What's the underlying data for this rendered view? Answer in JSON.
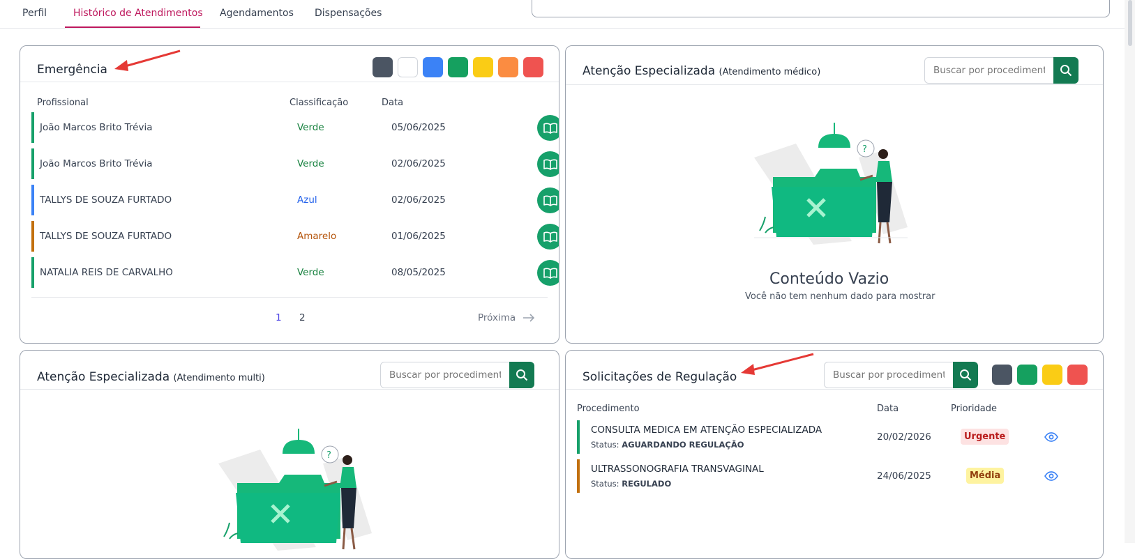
{
  "tabs": [
    {
      "label": "Perfil",
      "active": false
    },
    {
      "label": "Histórico de Atendimentos",
      "active": true
    },
    {
      "label": "Agendamentos",
      "active": false
    },
    {
      "label": "Dispensações",
      "active": false
    }
  ],
  "colors": {
    "accent": "#be185d",
    "primary_green": "#16a06a",
    "dark_green": "#137a52",
    "annotation_arrow": "#e53935"
  },
  "emergencia": {
    "title": "Emergência",
    "swatches": [
      "#4b5563",
      "#ffffff",
      "#3b82f6",
      "#15a05f",
      "#facc15",
      "#fb8c41",
      "#ef5350"
    ],
    "columns": {
      "profissional": "Profissional",
      "classificacao": "Classificação",
      "data": "Data"
    },
    "rows": [
      {
        "name": "João Marcos Brito Trévia",
        "class": "Verde",
        "date": "05/06/2025",
        "color": "#15803d",
        "bar": "#16a06a",
        "icon": "book-icon"
      },
      {
        "name": "João Marcos Brito Trévia",
        "class": "Verde",
        "date": "02/06/2025",
        "color": "#15803d",
        "bar": "#16a06a",
        "icon": "book-icon"
      },
      {
        "name": "TALLYS DE SOUZA FURTADO",
        "class": "Azul",
        "date": "02/06/2025",
        "color": "#2563eb",
        "bar": "#3b82f6",
        "icon": "book-icon"
      },
      {
        "name": "TALLYS DE SOUZA FURTADO",
        "class": "Amarelo",
        "date": "01/06/2025",
        "color": "#b45309",
        "bar": "#c2700d",
        "icon": "book-icon"
      },
      {
        "name": "NATALIA REIS DE CARVALHO",
        "class": "Verde",
        "date": "08/05/2025",
        "color": "#15803d",
        "bar": "#16a06a",
        "icon": "book-icon"
      }
    ],
    "pagination": {
      "pages": [
        "1",
        "2"
      ],
      "current": "1",
      "next_label": "Próxima",
      "next_icon": "arrow-right-icon"
    }
  },
  "atencao_medico": {
    "title": "Atenção Especializada",
    "subtitle": "(Atendimento médico)",
    "search_placeholder": "Buscar por procedimento...",
    "search_icon": "search-icon",
    "empty_title": "Conteúdo Vazio",
    "empty_subtitle": "Você não tem nenhum dado para mostrar"
  },
  "atencao_multi": {
    "title": "Atenção Especializada",
    "subtitle": "(Atendimento multi)",
    "search_placeholder": "Buscar por procedimento...",
    "search_icon": "search-icon"
  },
  "regulacao": {
    "title": "Solicitações de Regulação",
    "search_placeholder": "Buscar por procedimento...",
    "search_icon": "search-icon",
    "swatches": [
      "#4b5563",
      "#15a05f",
      "#facc15",
      "#ef5350"
    ],
    "columns": {
      "procedimento": "Procedimento",
      "data": "Data",
      "prioridade": "Prioridade"
    },
    "status_label": "Status:",
    "rows": [
      {
        "name": "CONSULTA MEDICA EM ATENÇÃO ESPECIALIZADA",
        "status": "AGUARDANDO REGULAÇÃO",
        "date": "20/02/2026",
        "priority": "Urgente",
        "bar": "#16a06a",
        "badge_bg": "#fde2e2",
        "badge_fg": "#b91c1c",
        "icon": "eye-icon"
      },
      {
        "name": "ULTRASSONOGRAFIA TRANSVAGINAL",
        "status": "REGULADO",
        "date": "24/06/2025",
        "priority": "Média",
        "bar": "#c2700d",
        "badge_bg": "#fef3a0",
        "badge_fg": "#92400e",
        "icon": "eye-icon"
      }
    ]
  }
}
